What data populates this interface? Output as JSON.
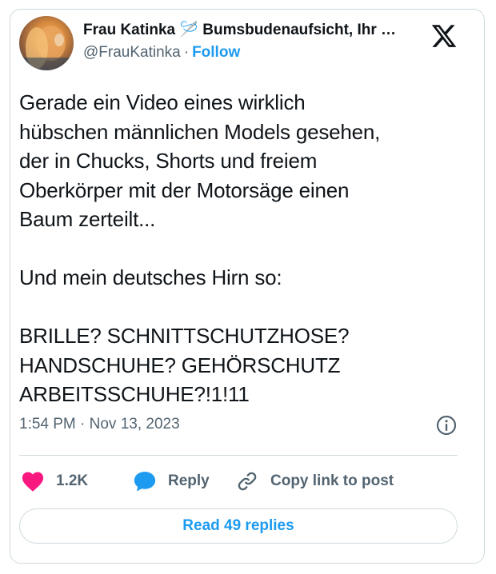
{
  "author": {
    "display_name": "Frau Katinka 🪡 Bumsbudenaufsicht, Ihr …",
    "handle": "@FrauKatinka",
    "separator": "·",
    "follow_label": "Follow"
  },
  "tweet": {
    "text": "Gerade ein Video eines wirklich\nhübschen männlichen Models gesehen,\nder in Chucks, Shorts und freiem\nOberkörper mit der Motorsäge einen\nBaum zerteilt...\n\nUnd mein deutsches Hirn so:\n\nBRILLE? SCHNITTSCHUTZHOSE?\nHANDSCHUHE? GEHÖRSCHUTZ\nARBEITSSCHUHE?!1!11",
    "timestamp": "1:54 PM · Nov 13, 2023"
  },
  "actions": {
    "like_count": "1.2K",
    "reply_label": "Reply",
    "copy_link_label": "Copy link to post"
  },
  "read_replies_label": "Read 49 replies",
  "icons": {
    "brand": "x-logo-icon",
    "info": "info-icon",
    "like": "heart-icon",
    "reply": "speech-bubble-icon",
    "copy": "link-icon"
  },
  "colors": {
    "accent": "#1d9bf0",
    "like": "#f91880",
    "muted_text": "#536471",
    "border": "#cfd9de"
  }
}
